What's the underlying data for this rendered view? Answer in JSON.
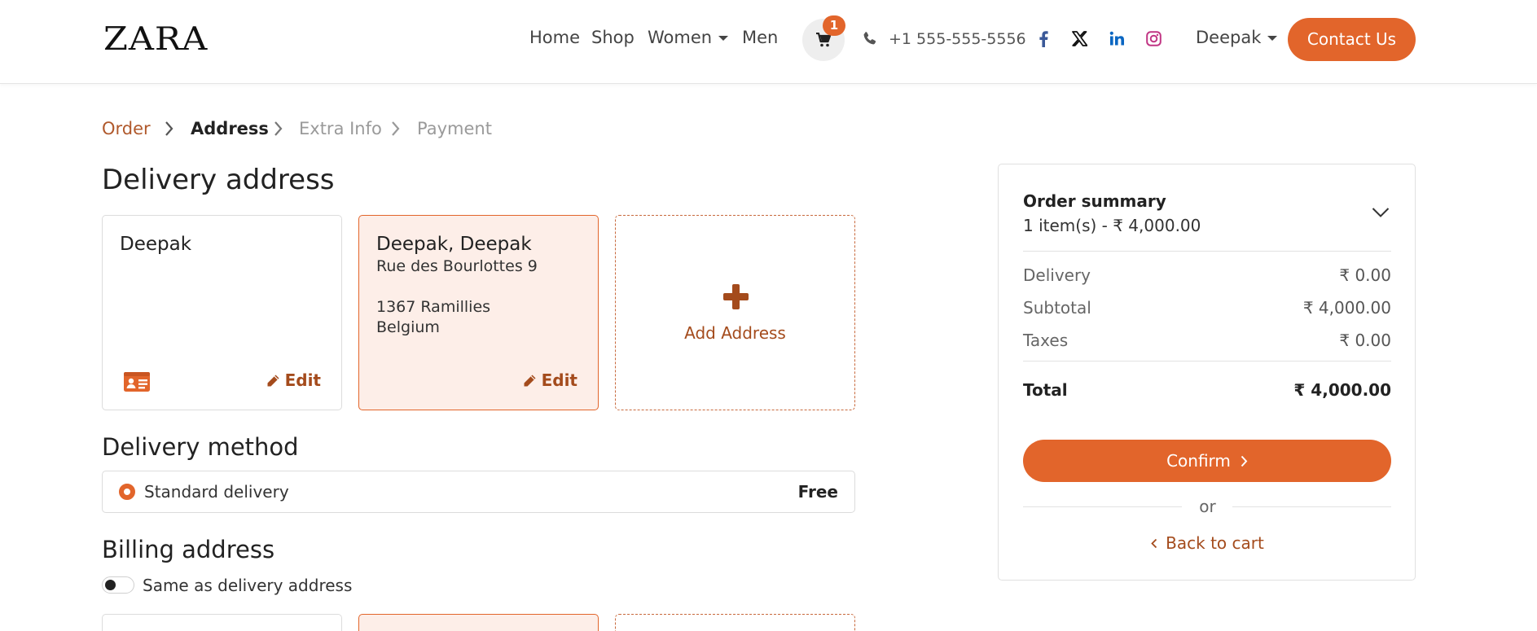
{
  "header": {
    "logo": "ZARA",
    "nav": [
      {
        "label": "Home"
      },
      {
        "label": "Shop"
      },
      {
        "label": "Women"
      },
      {
        "label": "Men"
      }
    ],
    "cart_count": "1",
    "phone": "+1 555-555-5556",
    "social_icons": [
      "facebook-icon",
      "x-icon",
      "linkedin-icon",
      "instagram-icon"
    ],
    "user": "Deepak",
    "contact_label": "Contact Us"
  },
  "breadcrumb": [
    {
      "label": "Order",
      "state": "done"
    },
    {
      "label": "Address",
      "state": "current"
    },
    {
      "label": "Extra Info",
      "state": "pending"
    },
    {
      "label": "Payment",
      "state": "pending"
    }
  ],
  "delivery": {
    "title": "Delivery address",
    "cards": [
      {
        "name": "Deepak",
        "edit": "Edit"
      },
      {
        "name": "Deepak, Deepak",
        "street": "Rue des Bourlottes 9",
        "city": "1367 Ramillies",
        "country": "Belgium",
        "edit": "Edit"
      }
    ],
    "add_label": "Add Address"
  },
  "method": {
    "title": "Delivery method",
    "option": "Standard delivery",
    "price": "Free"
  },
  "billing": {
    "title": "Billing address",
    "toggle_label": "Same as delivery address"
  },
  "summary": {
    "title": "Order summary",
    "items": "1 item(s) -  ₹ 4,000.00",
    "rows": [
      {
        "label": "Delivery",
        "value": "₹ 0.00"
      },
      {
        "label": "Subtotal",
        "value": "₹ 4,000.00"
      },
      {
        "label": "Taxes",
        "value": "₹ 0.00"
      }
    ],
    "total_label": "Total",
    "total_value": "₹ 4,000.00",
    "confirm_label": "Confirm",
    "or": "or",
    "back_label": "Back to cart"
  },
  "colors": {
    "accent": "#e2652b",
    "accent_dark": "#a44b1c",
    "selected_bg": "#fdeee8"
  }
}
